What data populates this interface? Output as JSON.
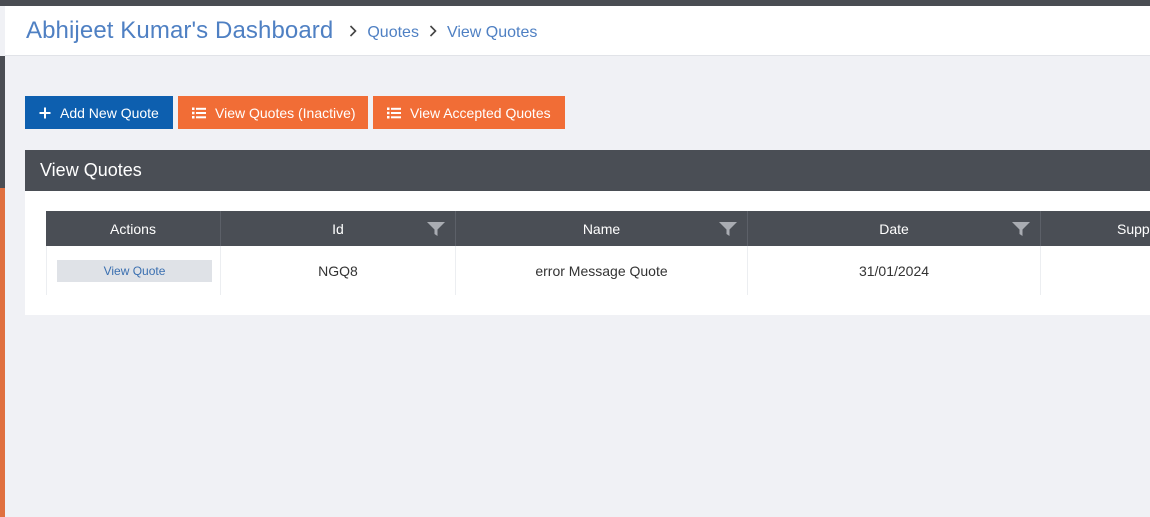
{
  "header": {
    "title": "Abhijeet Kumar's Dashboard",
    "breadcrumbs": [
      {
        "label": "Quotes"
      },
      {
        "label": "View Quotes"
      }
    ]
  },
  "actions": {
    "add_new": "Add New Quote",
    "view_inactive": "View Quotes (Inactive)",
    "view_accepted": "View Accepted Quotes"
  },
  "panel": {
    "title": "View Quotes"
  },
  "grid": {
    "columns": [
      "Actions",
      "Id",
      "Name",
      "Date",
      "Supp"
    ],
    "rows": [
      {
        "action_label": "View Quote",
        "id": "NGQ8",
        "name": "error Message Quote",
        "date": "31/01/2024",
        "supplier": ""
      }
    ]
  },
  "colors": {
    "accent_blue": "#0d5faf",
    "accent_orange": "#f16d36",
    "header_dark": "#4a4e55",
    "link_blue": "#4f80c3"
  }
}
